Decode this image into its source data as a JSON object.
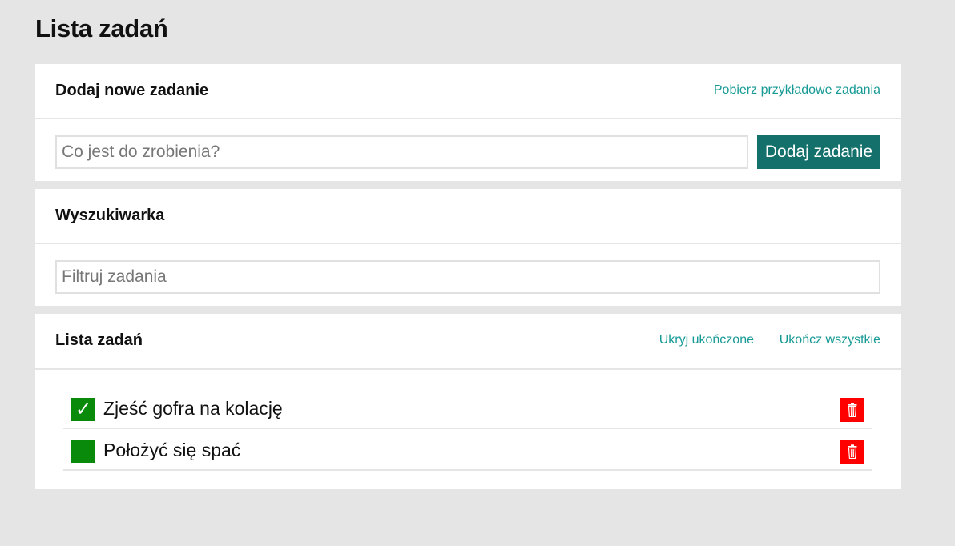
{
  "page": {
    "title": "Lista zadań"
  },
  "add_card": {
    "title": "Dodaj nowe zadanie",
    "sample_link": "Pobierz przykładowe zadania",
    "input_placeholder": "Co jest do zrobienia?",
    "input_value": "",
    "add_button": "Dodaj zadanie"
  },
  "search_card": {
    "title": "Wyszukiwarka",
    "input_placeholder": "Filtruj zadania",
    "input_value": ""
  },
  "list_card": {
    "title": "Lista zadań",
    "hide_completed_link": "Ukryj ukończone",
    "complete_all_link": "Ukończ wszystkie",
    "tasks": [
      {
        "label": "Zjeść gofra na kolację",
        "completed": true,
        "check_glyph": "✓"
      },
      {
        "label": "Położyć się spać",
        "completed": false,
        "check_glyph": ""
      }
    ]
  },
  "colors": {
    "background": "#e5e5e5",
    "accent_link": "#179a95",
    "add_button": "#13706b",
    "checkbox": "#0a8a0a",
    "delete_button": "#ff0000"
  },
  "icons": {
    "checkbox": "checkmark-icon",
    "delete": "trash-icon"
  }
}
